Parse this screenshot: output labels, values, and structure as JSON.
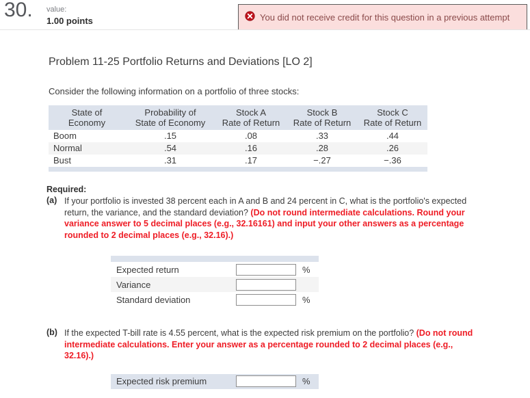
{
  "header": {
    "question_number": "30.",
    "value_label": "value:",
    "points": "1.00 points",
    "alert_icon": "error-circle-x-icon",
    "alert_message": "You did not receive credit for this question in a previous attempt",
    "alert_bg": "#fbdedd",
    "alert_border": "#5b5b5b",
    "alert_text_color": "#8a4a4a"
  },
  "problem": {
    "title": "Problem 11-25 Portfolio Returns and Deviations [LO 2]",
    "intro": "Consider the following information on a portfolio of three stocks:"
  },
  "data_table": {
    "header_bg": "#dce2ec",
    "columns": [
      {
        "line1": "State of",
        "line2": "Economy"
      },
      {
        "line1": "Probability of",
        "line2": "State of Economy"
      },
      {
        "line1": "Stock A",
        "line2": "Rate of Return"
      },
      {
        "line1": "Stock B",
        "line2": "Rate of Return"
      },
      {
        "line1": "Stock C",
        "line2": "Rate of Return"
      }
    ],
    "rows": [
      {
        "state": "Boom",
        "probability": ".15",
        "stock_a": ".08",
        "stock_b": ".33",
        "stock_c": ".44"
      },
      {
        "state": "Normal",
        "probability": ".54",
        "stock_a": ".16",
        "stock_b": ".28",
        "stock_c": ".26"
      },
      {
        "state": "Bust",
        "probability": ".31",
        "stock_a": ".17",
        "stock_b": "−.27",
        "stock_c": "−.36"
      }
    ]
  },
  "required": {
    "label": "Required:",
    "part_a": {
      "marker": "(a)",
      "text": "If your portfolio is invested 38 percent each in A and B and 24 percent in C, what is the portfolio's expected return, the variance, and the standard deviation? ",
      "note": "(Do not round intermediate calculations. Round your variance answer to 5 decimal places (e.g., 32.16161) and input your other answers as a percentage rounded to 2 decimal places (e.g., 32.16).)",
      "note_color": "#ee1c25"
    },
    "part_b": {
      "marker": "(b)",
      "text": "If the expected T-bill rate is 4.55 percent, what is the expected risk premium on the portfolio? ",
      "note": "(Do not round intermediate calculations. Enter your answer as a percentage rounded to 2 decimal places (e.g., 32.16).)",
      "note_color": "#ee1c25"
    }
  },
  "answers_a": {
    "rows": [
      {
        "label": "Expected return",
        "value": "",
        "suffix": "%",
        "shaded": false
      },
      {
        "label": "Variance",
        "value": "",
        "suffix": "",
        "shaded": true
      },
      {
        "label": "Standard deviation",
        "value": "",
        "suffix": "%",
        "shaded": false
      }
    ]
  },
  "answers_b": {
    "rows": [
      {
        "label": "Expected risk premium",
        "value": "",
        "suffix": "%"
      }
    ]
  }
}
